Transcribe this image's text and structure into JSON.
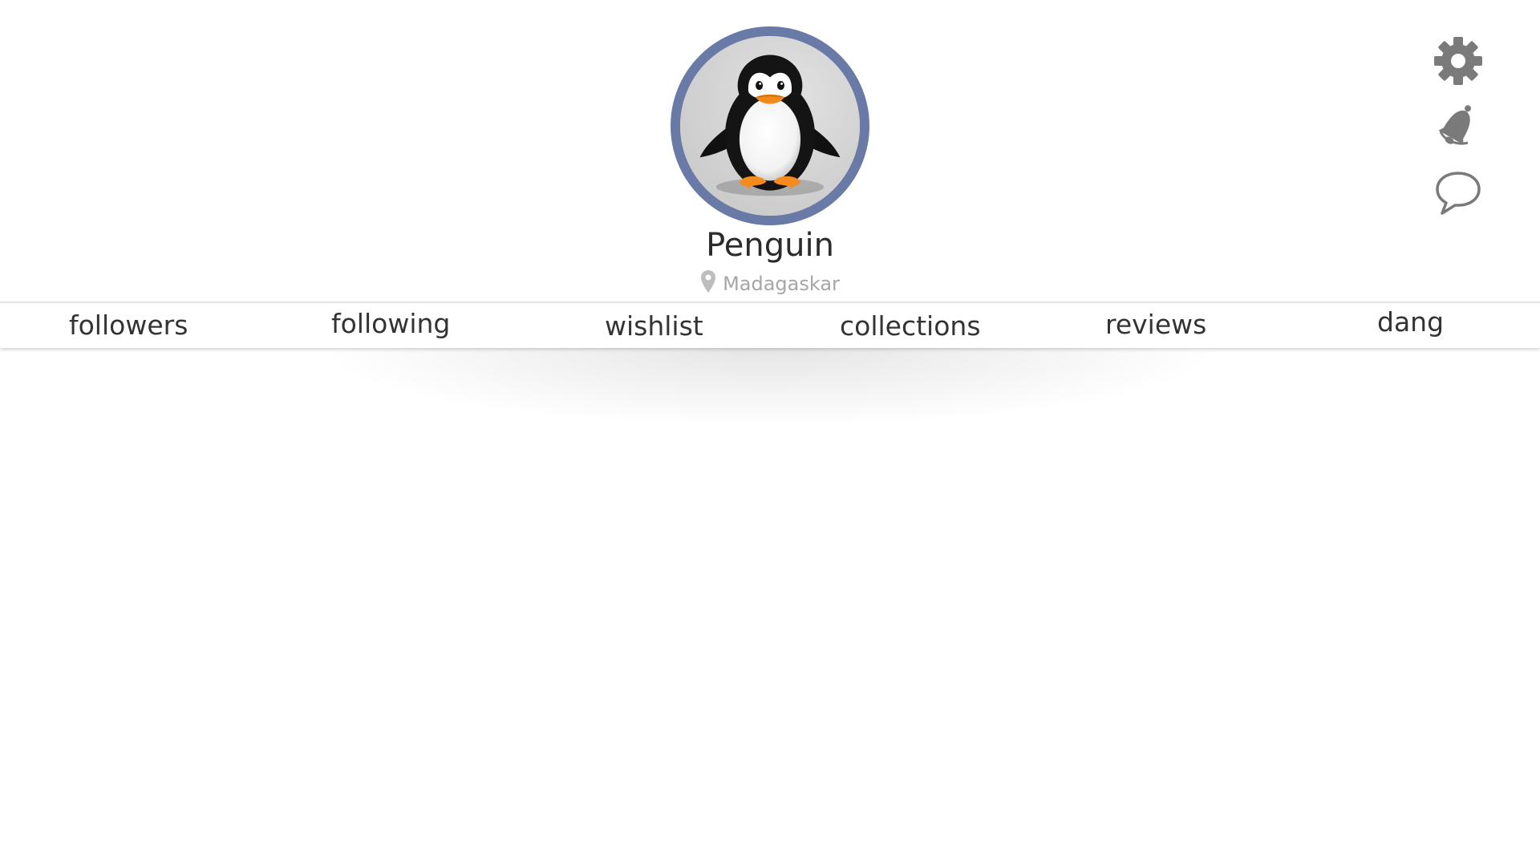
{
  "profile": {
    "name": "Penguin",
    "location": "Madagaskar",
    "avatar_icon": "penguin-avatar",
    "avatar_ring_color": "#6a7aa6"
  },
  "side_icons": [
    {
      "name": "settings-icon"
    },
    {
      "name": "bell-icon"
    },
    {
      "name": "chat-bubble-icon"
    }
  ],
  "tabs": [
    {
      "label": "followers"
    },
    {
      "label": "following"
    },
    {
      "label": "wishlist"
    },
    {
      "label": "collections"
    },
    {
      "label": "reviews"
    },
    {
      "label": "dang"
    }
  ],
  "colors": {
    "text": "#333333",
    "muted": "#a6a6a6",
    "icon": "#7a7a7a"
  }
}
